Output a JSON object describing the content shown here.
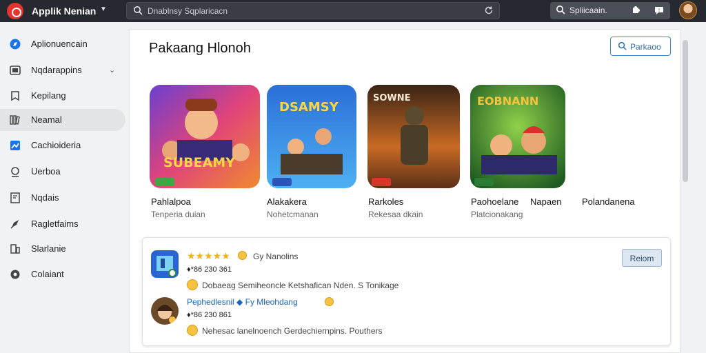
{
  "topbar": {
    "app_title": "Applik Nenian",
    "search_placeholder": "Dnablnsy Sqplaricacn",
    "right_search": "Spliicaain."
  },
  "sidebar": {
    "items": [
      {
        "label": "Aplionuencain",
        "icon": "compass-icon"
      },
      {
        "label": "Nqdarappins",
        "icon": "apps-icon"
      },
      {
        "label": "Kepilang",
        "icon": "bookmark-icon"
      },
      {
        "label": "Neamal",
        "icon": "library-icon"
      },
      {
        "label": "Cachioideria",
        "icon": "chart-icon"
      },
      {
        "label": "Uerboa",
        "icon": "user-icon"
      },
      {
        "label": "Nqdais",
        "icon": "document-icon"
      },
      {
        "label": "Ragletfaims",
        "icon": "rocket-icon"
      },
      {
        "label": "Slarlanie",
        "icon": "device-icon"
      },
      {
        "label": "Colaiant",
        "icon": "settings-icon"
      }
    ]
  },
  "main": {
    "title": "Pakaang Hlonoh",
    "search_button": "Parkaoo",
    "apps": [
      {
        "name": "Pahlalpoa",
        "subtitle": "Tenperia duian",
        "icon_text": "SUBEAMY"
      },
      {
        "name": "Alakakera",
        "subtitle": "Nohetcmanan",
        "icon_text": "DSAMSY"
      },
      {
        "name": "Rarkoles",
        "subtitle": "Rekesaa dkain",
        "icon_text": "SOWNE"
      },
      {
        "name": "Paohoelane",
        "subtitle": "Platcionakang",
        "icon_text": "EOBNANN"
      }
    ],
    "extra_names": [
      "Napaen",
      "Polandanena"
    ]
  },
  "reviews": {
    "first": {
      "stars": "★★★★★",
      "author": "Gy Nanolins",
      "meta": "♦*86 230 361",
      "text": "Dobaeag Semiheoncle Ketshafican Nden. S Tonikage"
    },
    "second": {
      "author": "Pephedlesnil ◆ Fy Mleohdang",
      "meta": "♦*86 230 861",
      "text": "Nehesac lanelnoench Gerdechiernpins. Pouthers"
    },
    "report_button": "Reiom"
  },
  "colors": {
    "topbar_bg": "#26292f",
    "accent": "#3f8ec9",
    "brand_red": "#e8322d",
    "link_blue": "#1a64b8"
  }
}
